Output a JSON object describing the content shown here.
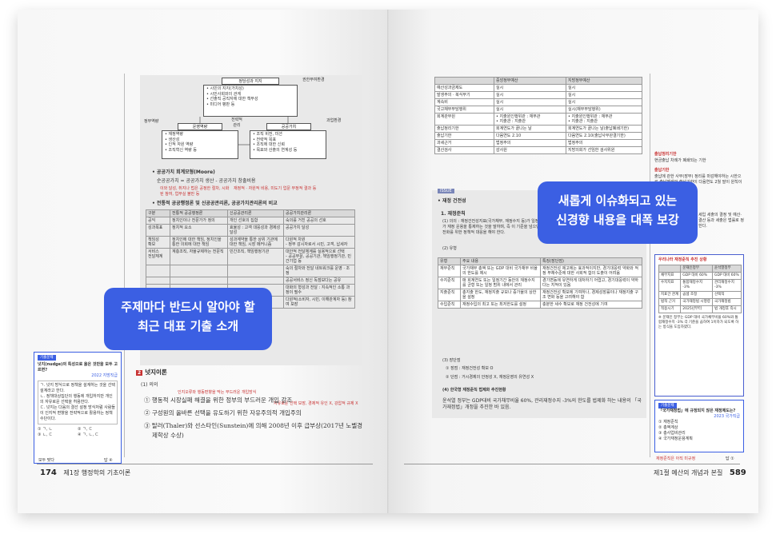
{
  "callouts": {
    "left_line1": "주제마다 반드시 알아야 할",
    "left_line2": "최근 대표 기출 소개",
    "right_line1": "새롭게 이슈화되고 있는",
    "right_line2": "신경향 내용을 대폭 보강"
  },
  "left_page": {
    "folio_number": "174",
    "folio_text": "제1장 행정학의 기초이론",
    "diagram": {
      "top_box_title": "정당성과 지지",
      "top_box_items": [
        "• 시민의 지지(가치성)",
        "• 시민사회와의 관계",
        "• 선출직 공직자에 대한 책무성",
        "• 미디어 평판 등"
      ],
      "top_right_label": "권한부여환경",
      "left_label": "정부역량",
      "mid_label": "전략적\n관리",
      "right_label": "과업환경",
      "ops_box_title": "운영역량",
      "ops_box_items": [
        "• 재정역량",
        "• 생산성",
        "• 인적 자원 역량",
        "• 조직혁신 역량 등"
      ],
      "value_box_title": "공공가치",
      "value_box_items": [
        "• 조직 비전, 미션",
        "• 전략적 목표",
        "• 조직에 대한 신뢰",
        "• 목표와 산출의 연계성 등"
      ]
    },
    "bullet1_title": "• 공공가치 회계모형(Moore)",
    "bullet1_formula": "순공공가치 = 공공가치 생산 - 공공가치 창출비용",
    "bullet1_note_red": "이와 달성, 취지나 법은 공정한 절차, 시화된 참여, 업무실 불만 등",
    "bullet1_note_right": "재정적 · 자원적 비용, 미도기 업문 부정적 결과 등",
    "bullet2_title": "• 전통적 공공행정론 및 신공공관리론, 공공가치관리론의 비교",
    "compare_table": {
      "headers": [
        "구분",
        "전통적 공공행정론",
        "신공공관리론",
        "공공가치관리론"
      ],
      "rows": [
        [
          "공익",
          "정치인이나 전문가가 정의",
          "개인 선호의 집합",
          "숙의를 거친 공공의 선호"
        ],
        [
          "성과목표",
          "정치적 요소",
          "효율성 : 고객 대응성과 경제성 달성",
          "공공가치 달성"
        ],
        [
          "책임성\n확보",
          "정치인에 대한 책임, 정치인을 통한 의회에 대한 책임",
          "성과계약을 통한 상위 기관에 대한 책임, 시장 메커니즘",
          "다원적 차원\n- 정부 감시자로서 시민, 고객, 납세자"
        ],
        [
          "서비스\n전달체계",
          "계층조직, 자율규제하는 전문직",
          "민간조직, 책임행정기관",
          "대안적 전달체계를 실용적으로 선택\n- 공공부문, 공공기관, 책임행정기관, 민간기업 등"
        ],
        [
          "",
          "",
          "",
          "숙의 절차와 전달 네트워크를 운영 · 조정"
        ],
        [
          "",
          "",
          "",
          "공공서비스 정신 독점보다는 공유"
        ],
        [
          "",
          "",
          "",
          "대화의 형성과 전달 : 지속적인 소통 과정이 필수"
        ],
        [
          "",
          "",
          "",
          "다원적(소비자, 시민, 이해관계자 등) 참여 보장"
        ]
      ]
    },
    "quiz": {
      "tag": "기출문제",
      "question": "넛지(nudge)의 특성으로 옳은 것만을 모두 고르면?",
      "source": "2022 지방직급",
      "items": [
        "ㄱ. 넛지 방식으로 정책을 설계하는 것을 선택설계라고 한다.",
        "ㄴ. 정책대상집단의 행동에 개입하지만 개인의 자유로운 선택을 허용한다.",
        "ㄷ. 넛지는 다음의 결선 설정 방식처럼 사람들이 인지적 편향을 전략적으로 활용하는 정책수단이다."
      ],
      "choices": [
        "① ㄱ, ㄴ",
        "② ㄱ, ㄷ",
        "③ ㄴ, ㄷ",
        "④ ㄱ, ㄴ, ㄷ"
      ],
      "footer_left": "모두 맞다",
      "footer_right": "답 ④"
    },
    "section2": {
      "badge": "2",
      "title": "넛지이론",
      "subsection": "(1) 의의",
      "note1": "인지오류와 행동편향을 막는 부드러운 개입방식",
      "note2": "자유로운 선택 보장, 경제적 유인 X, 강압적 규제 X",
      "lines": [
        "① 행동적 시장실패 해결을 위한 정부의 부드러운 개입 강조",
        "② 구성원의 올바른 선택을 유도하기 위한 자유주의적 개입주의",
        "③ 탈러(Thaler)와 선스타인(Sunstein)에 의해 2008년 이후 급부상(2017년 노벨경",
        "제학상 수상)"
      ]
    }
  },
  "right_page": {
    "folio_number": "589",
    "folio_text": "제1절 예산의 개념과 본질",
    "top_table": {
      "headers": [
        "",
        "중앙정부예산",
        "지방정부예산"
      ],
      "rows": [
        [
          "예산성과금제도",
          "실시",
          "실시"
        ],
        [
          "발생주의 · 복식부기",
          "실시",
          "실시"
        ],
        [
          "계속비",
          "실시",
          "실시"
        ],
        [
          "국고채무부담행위",
          "실시",
          "실시(채무부담행위)"
        ],
        [
          "회계관부원",
          "• 지출원인행위관 : 재무관\n• 지출관 : 지출관",
          "• 지출원인행위관 : 재무관\n• 지출관 : 지출관"
        ],
        [
          "출납정리기한",
          "회계연도가 끝나는 날",
          "회계연도가 끝나는 날(출납폐쇄기한)"
        ],
        [
          "출납기한",
          "다음연도 2.10",
          "다음연도 2.10(출납사무완결기한)"
        ],
        [
          "과세근거",
          "법정주의",
          "법정주의"
        ],
        [
          "결산검사",
          "감사원",
          "지방의회가 선임한 검사위원"
        ]
      ]
    },
    "issue_tag": "ISSUE",
    "issue_title": "• 재정 건전성",
    "issue_sub1": "1. 재정준칙",
    "issue_sub1_text": "(1) 의의 : 재정건전성지표(국가채무, 재정수지 등)가 일정 수준을 넘어서지 않도록 국가 재정 운용을 통제하는 것을 말하며, 즉 이 기준을 넘으면 국가는 의무적으로 재정건전화를 위한 정책적 대응을 해야 한다.",
    "types_label": "(2) 유형",
    "types_table": {
      "headers": [
        "유형",
        "주요 내용",
        "특징(장단점)"
      ],
      "rows": [
        [
          "재무준칙",
          "국가채무 총액 또는 GDP 대비 국가채무 비율의 한도를 제시",
          "재정건전성 제고에는 효과적이지만, 경기대응력 약화와 적정 부채수준에 대한 사회적 합의 도출이 어려움"
        ],
        [
          "수지준칙",
          "매 회계연도 또는 일정기간 동안의 재정수지를 균형 또는 일정 범위 내에서 관리",
          "경기변동에 유연하게 대처하기 어렵고, 경기대응력이 약하다는 지적이 있음"
        ],
        [
          "지출준칙",
          "총지출 한도, 재정지출 규모나 증가율의 상한을 설정",
          "재정건전성 확보에 기여하나, 경제성장률이나 재정지출 구조 변화 등을 고려해야 함"
        ],
        [
          "수입준칙",
          "재정수입의 최고 또는 최저한도를 설정",
          "충분한 세수 확보로 재정 건전성에 기여"
        ]
      ]
    },
    "pros_label": "(3) 장단점",
    "pros1": "① 장점 : 재정건전성 확보 O",
    "pros2": "② 단점 : 거시경제의 안정성 X, 재정운영의 유연성 X",
    "korea_label": "(4) 한국형 재정준칙 법제화 추진현황",
    "korea_text": "윤석열 정부는 GDP대비 국가채무비율 60%, 관리재정수지 -3%의 한도를 법제화 하는 내용의 「국가재정법」개정을 추진한 바 있음.",
    "side_notes": {
      "note1_title": "출납정리기한",
      "note1_text": "현금출납 차례가 폐쇄되는 기한",
      "note2_title": "출납기한",
      "note2_text": "출납에 관한 사무(장부) 정리를 마감해야하는 시한으로 출납폐쇄와 출납기한이 다음연도 2월 말이 원칙이다.",
      "note3_text": "세입 세출의 결정 및 예산·결산 등과 세출은 법률로 정한다."
    },
    "fiscal_box": {
      "title": "우리나라 재정준칙 추진 상황",
      "headers": [
        "",
        "문재인정부",
        "윤석열정부"
      ],
      "rows": [
        [
          "채무지표",
          "GDP 대비 60%",
          "GDP 대비 60%"
        ],
        [
          "수지지표",
          "통합재정수지\n-3%",
          "관리재정수지\n-3%"
        ],
        [
          "지표간 관계",
          "곱셈 조정",
          "선택적"
        ],
        [
          "법적 근거",
          "국가재정법 시행령",
          "국가재정법"
        ],
        [
          "적용시기",
          "2025년부터",
          "법 개정후 즉시"
        ]
      ],
      "note": "※ 문재인 정부는 GDP 대비 국가채무비율 60%와 통합재정수지 -3% 각 기준을 곱하여 1이하가 되도록 하는 방식을 도입하였다."
    },
    "quiz": {
      "tag": "기출문제",
      "question": "「국가재정법」에 규정되지 않은 재정제도는?",
      "source": "2023 국가직급",
      "choices": [
        "① 재정준칙",
        "② 총액계상",
        "③ 총사업비관리",
        "④ 국가재정운용계획"
      ],
      "footer_left": "재정준칙은 아직 미규정",
      "footer_right": "답 ①"
    }
  }
}
